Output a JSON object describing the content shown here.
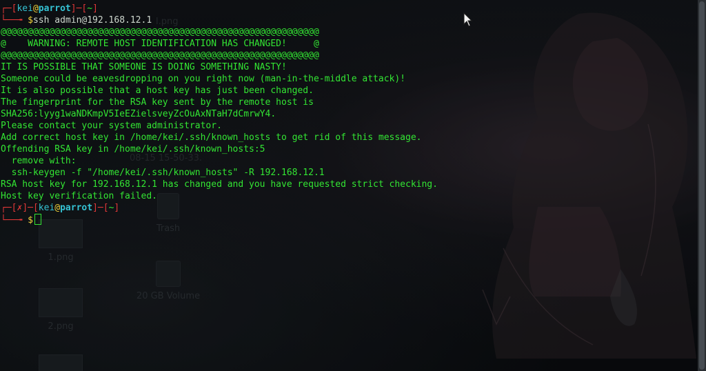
{
  "desktop": {
    "icons": [
      {
        "label": "Trash"
      },
      {
        "label": "1.png"
      },
      {
        "label": "20 GB Volume"
      },
      {
        "label": "2.png"
      }
    ],
    "faint_texts": [
      "l.png",
      "08-15 15-50-33."
    ]
  },
  "terminal": {
    "prompt1": {
      "user": "kei",
      "at": "@",
      "host": "parrot",
      "dir": "~",
      "symbol": "$",
      "command": "ssh admin@192.168.12.1"
    },
    "output": [
      "@@@@@@@@@@@@@@@@@@@@@@@@@@@@@@@@@@@@@@@@@@@@@@@@@@@@@@@@@@@",
      "@    WARNING: REMOTE HOST IDENTIFICATION HAS CHANGED!     @",
      "@@@@@@@@@@@@@@@@@@@@@@@@@@@@@@@@@@@@@@@@@@@@@@@@@@@@@@@@@@@",
      "IT IS POSSIBLE THAT SOMEONE IS DOING SOMETHING NASTY!",
      "Someone could be eavesdropping on you right now (man-in-the-middle attack)!",
      "It is also possible that a host key has just been changed.",
      "The fingerprint for the RSA key sent by the remote host is",
      "SHA256:lyyg1waNDKmpV5IeEZielsveyZcOuAxNTaH7dCmrwY4.",
      "Please contact your system administrator.",
      "Add correct host key in /home/kei/.ssh/known_hosts to get rid of this message.",
      "Offending RSA key in /home/kei/.ssh/known_hosts:5",
      "  remove with:",
      "  ssh-keygen -f \"/home/kei/.ssh/known_hosts\" -R 192.168.12.1",
      "RSA host key for 192.168.12.1 has changed and you have requested strict checking.",
      "Host key verification failed."
    ],
    "prompt2": {
      "status": "✗",
      "user": "kei",
      "at": "@",
      "host": "parrot",
      "dir": "~",
      "symbol": "$"
    }
  },
  "colors": {
    "prompt_bracket": "#e23838",
    "prompt_user": "#35c3d4",
    "prompt_symbol": "#f2d43a",
    "output_text": "#33e633"
  },
  "icons": [
    "mouse-pointer-icon",
    "trash-icon",
    "image-file-icon",
    "drive-icon"
  ]
}
